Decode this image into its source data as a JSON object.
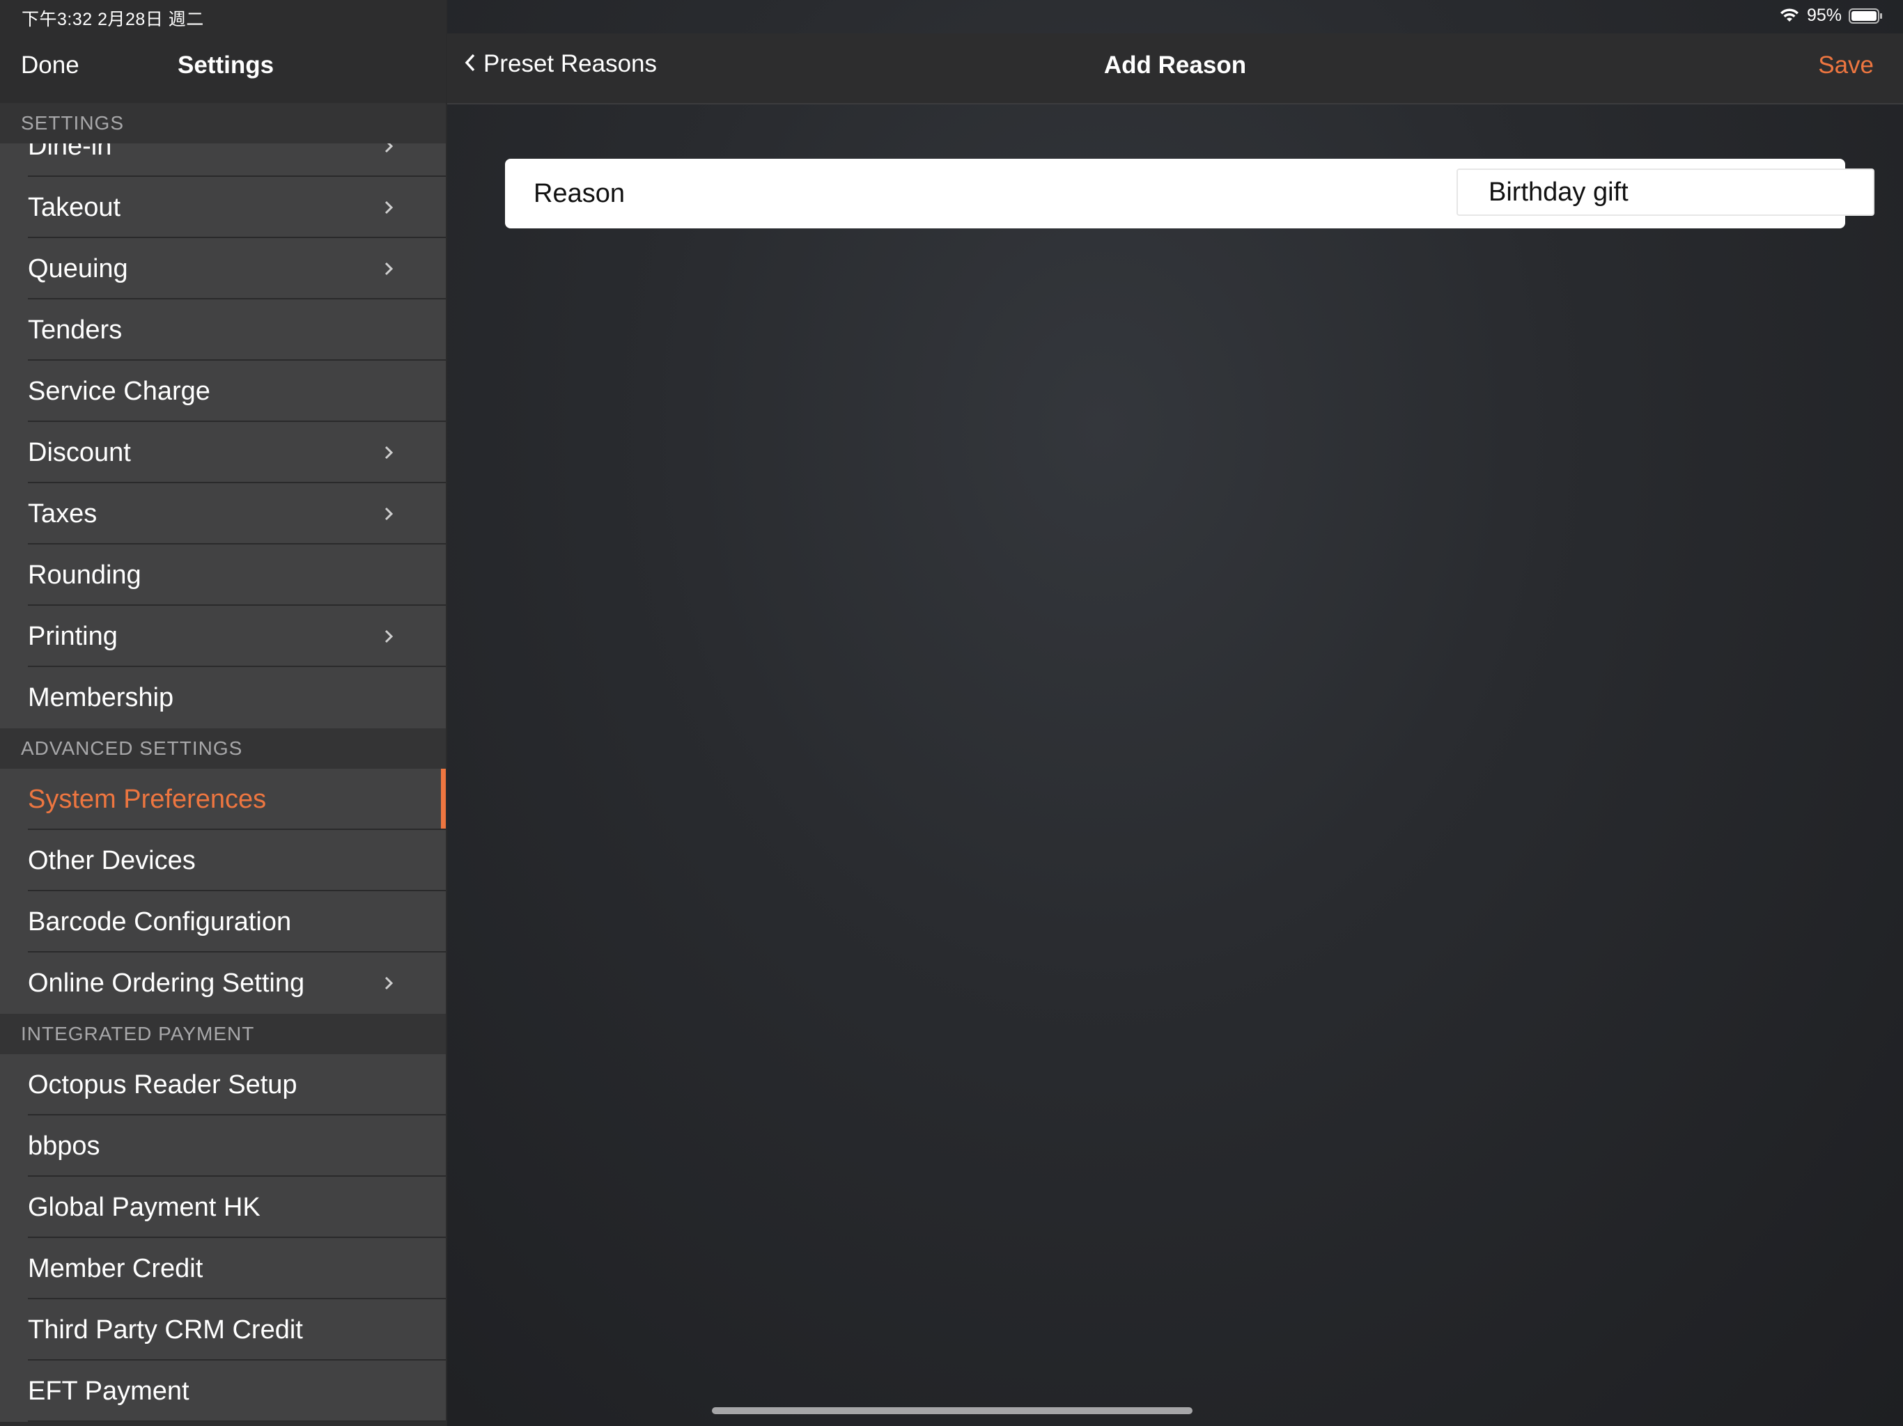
{
  "status_bar": {
    "time": "下午3:32   2月28日 週二",
    "battery": "95%"
  },
  "sidebar": {
    "done_label": "Done",
    "title": "Settings",
    "sections": [
      {
        "header": "SETTINGS",
        "items": [
          {
            "label": "Dine-in",
            "chevron": true
          },
          {
            "label": "Takeout",
            "chevron": true
          },
          {
            "label": "Queuing",
            "chevron": true
          },
          {
            "label": "Tenders",
            "chevron": false
          },
          {
            "label": "Service Charge",
            "chevron": false
          },
          {
            "label": "Discount",
            "chevron": true
          },
          {
            "label": "Taxes",
            "chevron": true
          },
          {
            "label": "Rounding",
            "chevron": false
          },
          {
            "label": "Printing",
            "chevron": true
          },
          {
            "label": "Membership",
            "chevron": false
          }
        ]
      },
      {
        "header": "ADVANCED SETTINGS",
        "items": [
          {
            "label": "System Preferences",
            "chevron": false,
            "active": true
          },
          {
            "label": "Other Devices",
            "chevron": false
          },
          {
            "label": "Barcode Configuration",
            "chevron": false
          },
          {
            "label": "Online Ordering Setting",
            "chevron": true
          }
        ]
      },
      {
        "header": "INTEGRATED PAYMENT",
        "items": [
          {
            "label": "Octopus Reader Setup",
            "chevron": false
          },
          {
            "label": "bbpos",
            "chevron": false
          },
          {
            "label": "Global Payment HK",
            "chevron": false
          },
          {
            "label": "Member Credit",
            "chevron": false
          },
          {
            "label": "Third Party CRM Credit",
            "chevron": false
          },
          {
            "label": "EFT Payment",
            "chevron": false
          }
        ]
      }
    ]
  },
  "main": {
    "back_label": "Preset Reasons",
    "title": "Add Reason",
    "save_label": "Save",
    "form": {
      "label": "Reason",
      "value": "Birthday gift"
    }
  },
  "colors": {
    "accent": "#ee7640",
    "sidebar_row": "#424243",
    "section_header": "#343435"
  }
}
